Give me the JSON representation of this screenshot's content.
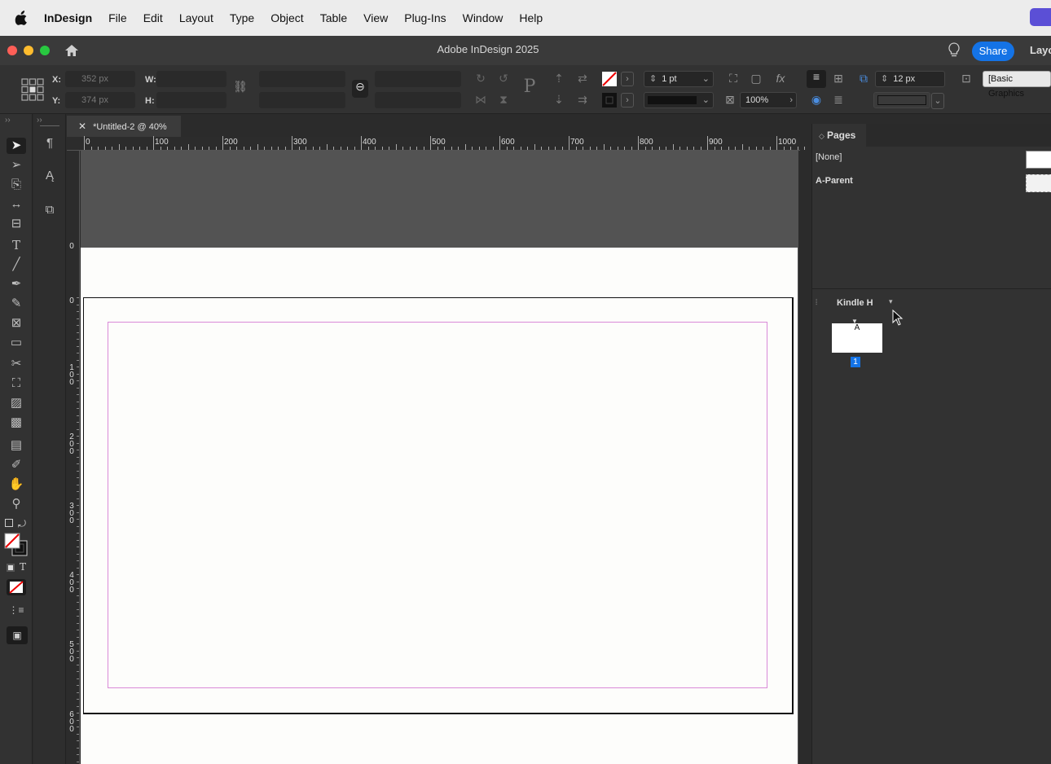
{
  "menubar": {
    "app": "InDesign",
    "items": [
      "File",
      "Edit",
      "Layout",
      "Type",
      "Object",
      "Table",
      "View",
      "Plug-Ins",
      "Window",
      "Help"
    ]
  },
  "titlebar": {
    "title": "Adobe InDesign 2025",
    "share": "Share",
    "workspace": "Layo"
  },
  "control": {
    "x_label": "X:",
    "y_label": "Y:",
    "w_label": "W:",
    "h_label": "H:",
    "x_value": "352 px",
    "y_value": "374 px",
    "stroke_weight": "1 pt",
    "opacity": "100%",
    "gap": "12 px",
    "object_style": "[Basic Graphics"
  },
  "document": {
    "tab_title": "*Untitled-2 @ 40%",
    "hruler": [
      "0",
      "100",
      "200",
      "300",
      "400",
      "500",
      "600",
      "700",
      "800",
      "900",
      "1000"
    ],
    "vruler": [
      "0",
      "0",
      "1\n0\n0",
      "2\n0\n0",
      "3\n0\n0",
      "4\n0\n0",
      "5\n0\n0",
      "6\n0\n0"
    ]
  },
  "pages_panel": {
    "title": "Pages",
    "parents": [
      "[None]",
      "A-Parent"
    ],
    "preset": "Kindle H",
    "page_prefix": "A",
    "page_number": "1"
  },
  "colors": {
    "accent": "#1473e6",
    "margin_guide": "#d98ad8",
    "page": "#fdfdfb"
  }
}
